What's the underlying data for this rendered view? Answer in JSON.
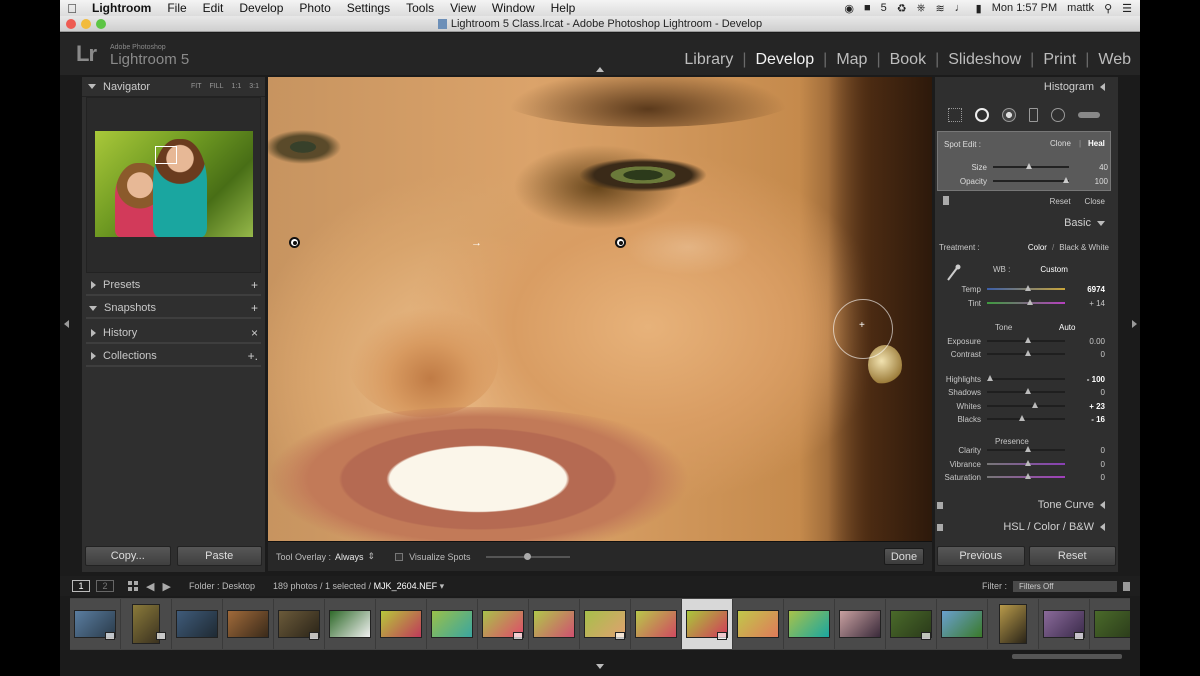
{
  "menubar": {
    "app": "Lightroom",
    "items": [
      "File",
      "Edit",
      "Develop",
      "Photo",
      "Settings",
      "Tools",
      "View",
      "Window",
      "Help"
    ],
    "status_text": "5",
    "clock": "Mon 1:57 PM",
    "user": "mattk"
  },
  "window": {
    "title": "Lightroom 5 Class.lrcat - Adobe Photoshop Lightroom - Develop"
  },
  "identity": {
    "logo": "Lr",
    "line1": "Adobe Photoshop",
    "line2": "Lightroom 5"
  },
  "modules": {
    "items": [
      "Library",
      "Develop",
      "Map",
      "Book",
      "Slideshow",
      "Print",
      "Web"
    ],
    "active": "Develop"
  },
  "left_panel": {
    "navigator": {
      "title": "Navigator",
      "opts": [
        "FIT",
        "FILL",
        "1:1",
        "3:1"
      ]
    },
    "sections": [
      {
        "label": "Presets",
        "action": "+"
      },
      {
        "label": "Snapshots",
        "action": "+"
      },
      {
        "label": "History",
        "action": "×"
      },
      {
        "label": "Collections",
        "action": "+."
      }
    ],
    "copy_label": "Copy...",
    "paste_label": "Paste"
  },
  "toolbar": {
    "overlay_label": "Tool Overlay :",
    "overlay_value": "Always",
    "visualize_label": "Visualize Spots",
    "done_label": "Done"
  },
  "right_panel": {
    "histogram_title": "Histogram",
    "spot_edit": {
      "title": "Spot Edit :",
      "clone": "Clone",
      "heal": "Heal",
      "size_label": "Size",
      "size_value": "40",
      "size_pct": 0.45,
      "opacity_label": "Opacity",
      "opacity_value": "100",
      "opacity_pct": 0.96,
      "reset": "Reset",
      "close": "Close"
    },
    "basic": {
      "title": "Basic",
      "treatment_label": "Treatment :",
      "treatment_color": "Color",
      "treatment_bw": "Black & White",
      "wb_label": "WB :",
      "wb_value": "Custom",
      "tone_label": "Tone",
      "auto_label": "Auto",
      "presence_label": "Presence",
      "sliders": [
        {
          "label": "Temp",
          "value": "6974",
          "pct": 0.5,
          "bold": true,
          "track": "temp"
        },
        {
          "label": "Tint",
          "value": "+ 14",
          "pct": 0.53,
          "bold": false,
          "track": "tint"
        },
        {
          "label": "Exposure",
          "value": "0.00",
          "pct": 0.5,
          "bold": false,
          "track": ""
        },
        {
          "label": "Contrast",
          "value": "0",
          "pct": 0.5,
          "bold": false,
          "track": ""
        },
        {
          "label": "Highlights",
          "value": "- 100",
          "pct": 0.0,
          "bold": true,
          "track": ""
        },
        {
          "label": "Shadows",
          "value": "0",
          "pct": 0.5,
          "bold": false,
          "track": ""
        },
        {
          "label": "Whites",
          "value": "+ 23",
          "pct": 0.6,
          "bold": true,
          "track": ""
        },
        {
          "label": "Blacks",
          "value": "- 16",
          "pct": 0.42,
          "bold": true,
          "track": ""
        },
        {
          "label": "Clarity",
          "value": "0",
          "pct": 0.5,
          "bold": false,
          "track": ""
        },
        {
          "label": "Vibrance",
          "value": "0",
          "pct": 0.5,
          "bold": false,
          "track": "vib"
        },
        {
          "label": "Saturation",
          "value": "0",
          "pct": 0.5,
          "bold": false,
          "track": "sat"
        }
      ]
    },
    "tone_curve_title": "Tone Curve",
    "hsl_title": "HSL / Color / B&W",
    "previous_label": "Previous",
    "reset_label": "Reset"
  },
  "filmstrip": {
    "page1": "1",
    "page2": "2",
    "folder": "Folder : Desktop",
    "count": "189 photos / 1 selected /",
    "filename": "MJK_2604.NEF",
    "filter_label": "Filter :",
    "filter_value": "Filters Off",
    "selected_index": 12,
    "thumbs": [
      {
        "c1": "#5a7da0",
        "c2": "#2a3b4a",
        "tall": false,
        "badge": true
      },
      {
        "c1": "#8a7a3a",
        "c2": "#3b3220",
        "tall": true,
        "badge": true
      },
      {
        "c1": "#3f5b7a",
        "c2": "#1f2a33",
        "tall": false,
        "badge": false
      },
      {
        "c1": "#a06a3a",
        "c2": "#3a2a1a",
        "tall": false,
        "badge": false
      },
      {
        "c1": "#6b5a3a",
        "c2": "#2a2418",
        "tall": false,
        "badge": true
      },
      {
        "c1": "#2f6a2a",
        "c2": "#f0f0f0",
        "tall": false,
        "badge": false
      },
      {
        "c1": "#b6c83a",
        "c2": "#c03a5a",
        "tall": false,
        "badge": false
      },
      {
        "c1": "#9ac04a",
        "c2": "#3aa6a0",
        "tall": false,
        "badge": false
      },
      {
        "c1": "#a8c24a",
        "c2": "#e04a6a",
        "tall": false,
        "badge": true
      },
      {
        "c1": "#b0c84a",
        "c2": "#d05070",
        "tall": false,
        "badge": false
      },
      {
        "c1": "#a6c04a",
        "c2": "#e0a070",
        "tall": false,
        "badge": true
      },
      {
        "c1": "#b8c84a",
        "c2": "#d04a60",
        "tall": false,
        "badge": false
      },
      {
        "c1": "#a9c83a",
        "c2": "#d23a5a",
        "tall": false,
        "badge": true
      },
      {
        "c1": "#c0c84a",
        "c2": "#e07a5a",
        "tall": false,
        "badge": false
      },
      {
        "c1": "#a8c24a",
        "c2": "#1aa6a0",
        "tall": false,
        "badge": false
      },
      {
        "c1": "#c8a0a0",
        "c2": "#3a2a3a",
        "tall": false,
        "badge": false
      },
      {
        "c1": "#4a6a2a",
        "c2": "#2a3a1a",
        "tall": false,
        "badge": true
      },
      {
        "c1": "#6aa0d0",
        "c2": "#3a7a2a",
        "tall": false,
        "badge": false
      },
      {
        "c1": "#b89a4a",
        "c2": "#2a2418",
        "tall": true,
        "badge": false
      },
      {
        "c1": "#8a6a9a",
        "c2": "#3a2a4a",
        "tall": false,
        "badge": true
      },
      {
        "c1": "#4a6a2a",
        "c2": "#2a3a1a",
        "tall": false,
        "badge": false
      }
    ]
  }
}
